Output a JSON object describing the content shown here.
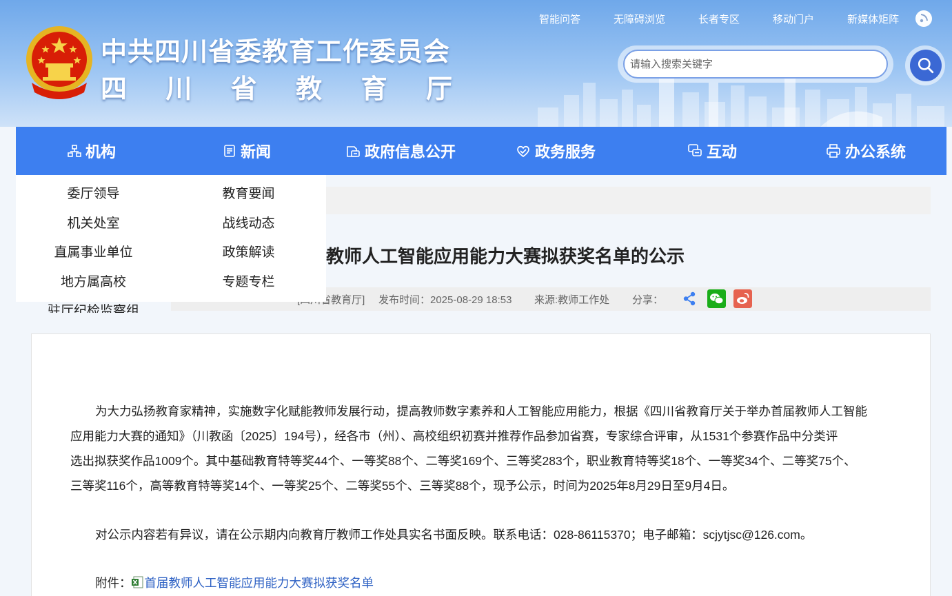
{
  "header": {
    "title_main": "中共四川省委教育工作委员会",
    "title_sub": [
      "四",
      "川",
      "省",
      "教",
      "育",
      "厅"
    ],
    "toplinks": [
      "智能问答",
      "无障碍浏览",
      "长者专区",
      "移动门户",
      "新媒体矩阵"
    ],
    "search_placeholder": "请输入搜索关键字"
  },
  "nav": {
    "items": [
      {
        "label": "机构",
        "icon": "org-chart-icon"
      },
      {
        "label": "新闻",
        "icon": "news-icon"
      },
      {
        "label": "政府信息公开",
        "icon": "info-disclosure-icon"
      },
      {
        "label": "政务服务",
        "icon": "heart-service-icon"
      },
      {
        "label": "互动",
        "icon": "chat-icon"
      },
      {
        "label": "办公系统",
        "icon": "printer-icon"
      }
    ]
  },
  "dropdown": {
    "col1": [
      "委厅领导",
      "机关处室",
      "直属事业单位",
      "地方属高校",
      "驻厅纪检监察组"
    ],
    "col2": [
      "教育要闻",
      "战线动态",
      "政策解读",
      "专题专栏"
    ]
  },
  "article": {
    "title": "教师人工智能应用能力大赛拟获奖名单的公示",
    "source_prefix": "[四川省教育厅]",
    "publish_time": "发布时间：2025-08-29 18:53",
    "origin": "来源:教师工作处",
    "share_label": "分享：",
    "para1_lines": [
      "为大力弘扬教育家精神，实施数字化赋能教师发展行动，提高教师数字素养和人工智能应用能力，根据《四川省教育厅关于举办首届教师人工智能",
      "应用能力大赛的通知》（川教函〔2025〕194号），经各市（州）、高校组织初赛并推荐作品参加省赛，专家综合评审，从1531个参赛作品中分类评",
      "选出拟获奖作品1009个。其中基础教育特等奖44个、一等奖88个、二等奖169个、三等奖283个，职业教育特等奖18个、一等奖34个、二等奖75个、",
      "三等奖116个，高等教育特等奖14个、一等奖25个、二等奖55个、三等奖88个，现予公示，时间为2025年8月29日至9月4日。"
    ],
    "para2": "对公示内容若有异议，请在公示期内向教育厅教师工作处具实名书面反映。联系电话：028-86115370；电子邮箱：scjytjsc@126.com。",
    "attach_label": "附件：",
    "attach_link": "首届教师人工智能应用能力大赛拟获奖名单"
  },
  "colors": {
    "nav_bg": "#3d7ff0",
    "search_button": "#3b68d4",
    "wechat": "#1aad19",
    "weibo": "#e6624f",
    "link": "#2f62c4"
  }
}
